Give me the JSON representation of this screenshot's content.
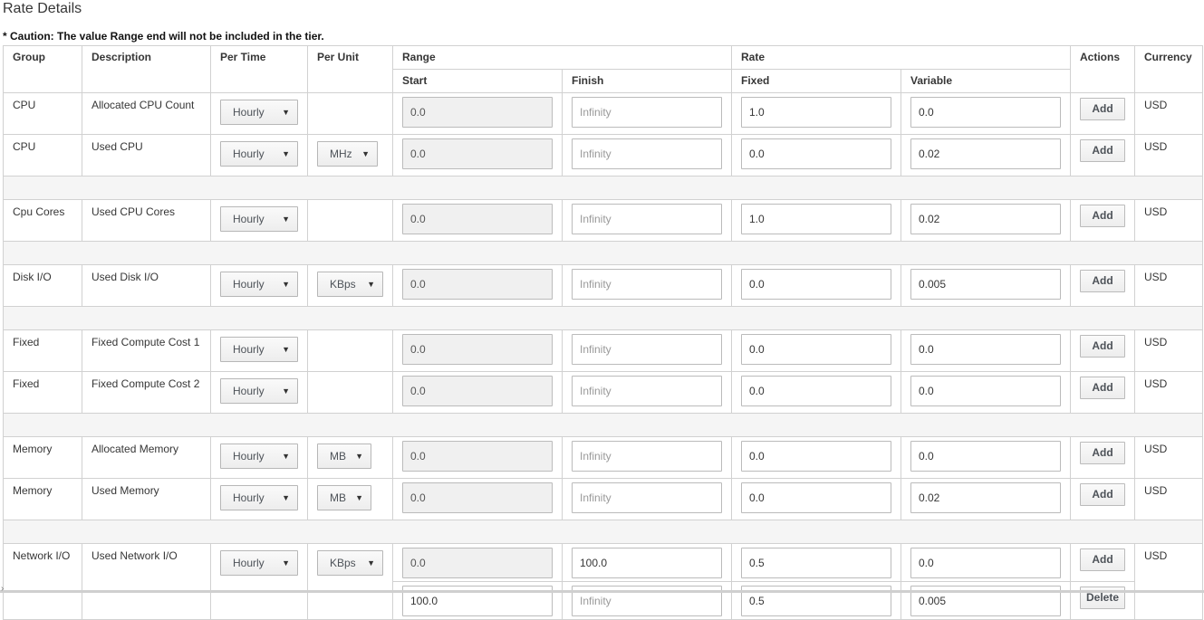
{
  "page": {
    "title": "Rate Details",
    "caution": "* Caution: The value Range end will not be included in the tier."
  },
  "headers": {
    "group": "Group",
    "description": "Description",
    "per_time": "Per Time",
    "per_unit": "Per Unit",
    "range": "Range",
    "rate": "Rate",
    "actions": "Actions",
    "currency": "Currency",
    "start": "Start",
    "finish": "Finish",
    "fixed": "Fixed",
    "variable": "Variable"
  },
  "labels": {
    "add": "Add",
    "delete": "Delete",
    "hourly": "Hourly",
    "infinity": "Infinity",
    "usd": "USD"
  },
  "rows": [
    {
      "group": "CPU",
      "description": "Allocated CPU Count",
      "unit": "",
      "tiers": [
        {
          "start": "0.0",
          "finish": "",
          "fixed": "1.0",
          "variable": "0.0"
        }
      ]
    },
    {
      "group": "CPU",
      "description": "Used CPU",
      "unit": "MHz",
      "tiers": [
        {
          "start": "0.0",
          "finish": "",
          "fixed": "0.0",
          "variable": "0.02"
        }
      ]
    },
    {
      "group": "Cpu Cores",
      "description": "Used CPU Cores",
      "unit": "",
      "tiers": [
        {
          "start": "0.0",
          "finish": "",
          "fixed": "1.0",
          "variable": "0.02"
        }
      ]
    },
    {
      "group": "Disk I/O",
      "description": "Used Disk I/O",
      "unit": "KBps",
      "tiers": [
        {
          "start": "0.0",
          "finish": "",
          "fixed": "0.0",
          "variable": "0.005"
        }
      ]
    },
    {
      "group": "Fixed",
      "description": "Fixed Compute Cost 1",
      "unit": "",
      "tiers": [
        {
          "start": "0.0",
          "finish": "",
          "fixed": "0.0",
          "variable": "0.0"
        }
      ]
    },
    {
      "group": "Fixed",
      "description": "Fixed Compute Cost 2",
      "unit": "",
      "tiers": [
        {
          "start": "0.0",
          "finish": "",
          "fixed": "0.0",
          "variable": "0.0"
        }
      ]
    },
    {
      "group": "Memory",
      "description": "Allocated Memory",
      "unit": "MB",
      "tiers": [
        {
          "start": "0.0",
          "finish": "",
          "fixed": "0.0",
          "variable": "0.0"
        }
      ]
    },
    {
      "group": "Memory",
      "description": "Used Memory",
      "unit": "MB",
      "tiers": [
        {
          "start": "0.0",
          "finish": "",
          "fixed": "0.0",
          "variable": "0.02"
        }
      ]
    },
    {
      "group": "Network I/O",
      "description": "Used Network I/O",
      "unit": "KBps",
      "tiers": [
        {
          "start": "0.0",
          "finish": "100.0",
          "fixed": "0.5",
          "variable": "0.0"
        },
        {
          "start": "100.0",
          "finish": "",
          "fixed": "0.5",
          "variable": "0.005"
        }
      ]
    }
  ]
}
